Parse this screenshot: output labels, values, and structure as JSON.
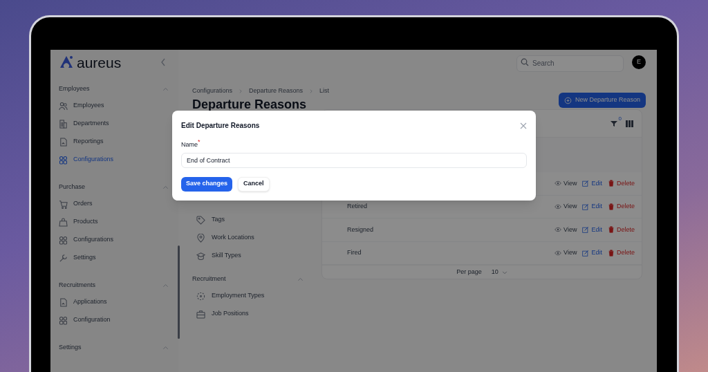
{
  "app": {
    "logo_text": "aureus",
    "search_placeholder": "Search",
    "avatar_initial": "E"
  },
  "sidebar": {
    "sections": [
      {
        "title": "Employees",
        "expanded": true,
        "items": [
          {
            "label": "Employees",
            "selected": false
          },
          {
            "label": "Departments",
            "selected": false
          },
          {
            "label": "Reportings",
            "selected": false
          },
          {
            "label": "Configurations",
            "selected": true
          }
        ]
      },
      {
        "title": "Purchase",
        "expanded": true,
        "items": [
          {
            "label": "Orders",
            "selected": false
          },
          {
            "label": "Products",
            "selected": false
          },
          {
            "label": "Configurations",
            "selected": false
          },
          {
            "label": "Settings",
            "selected": false
          }
        ]
      },
      {
        "title": "Recruitments",
        "expanded": true,
        "items": [
          {
            "label": "Applications",
            "selected": false
          },
          {
            "label": "Configuration",
            "selected": false
          }
        ]
      },
      {
        "title": "Settings",
        "expanded": true
      }
    ]
  },
  "breadcrumbs": [
    "Configurations",
    "Departure Reasons",
    "List"
  ],
  "page_title": "Departure Reasons",
  "new_button": "New Departure Reason",
  "config_nav": {
    "items": [
      {
        "label": "Tags"
      },
      {
        "label": "Work Locations"
      },
      {
        "label": "Skill Types"
      }
    ],
    "sections": [
      {
        "title": "Recruitment",
        "expanded": true,
        "items": [
          {
            "label": "Employment Types"
          },
          {
            "label": "Job Positions"
          }
        ]
      }
    ]
  },
  "table": {
    "filter_count": "0",
    "rows": [
      {
        "actions": [
          {
            "kind": "view",
            "label": "View"
          },
          {
            "kind": "edit",
            "label": "Edit"
          },
          {
            "kind": "delete",
            "label": "Delete"
          }
        ]
      },
      {
        "name": "Retired",
        "actions": [
          {
            "kind": "view",
            "label": "View"
          },
          {
            "kind": "edit",
            "label": "Edit"
          },
          {
            "kind": "delete",
            "label": "Delete"
          }
        ]
      },
      {
        "name": "Resigned",
        "actions": [
          {
            "kind": "view",
            "label": "View"
          },
          {
            "kind": "edit",
            "label": "Edit"
          },
          {
            "kind": "delete",
            "label": "Delete"
          }
        ]
      },
      {
        "name": "Fired",
        "actions": [
          {
            "kind": "view",
            "label": "View"
          },
          {
            "kind": "edit",
            "label": "Edit"
          },
          {
            "kind": "delete",
            "label": "Delete"
          }
        ]
      }
    ],
    "pagination": {
      "label": "Per page",
      "value": "10"
    }
  },
  "modal": {
    "title": "Edit Departure Reasons",
    "field_label": "Name",
    "required_marker": "*",
    "value": "End of Contract",
    "buttons": [
      {
        "kind": "primary",
        "label": "Save changes"
      },
      {
        "kind": "secondary",
        "label": "Cancel"
      }
    ]
  }
}
